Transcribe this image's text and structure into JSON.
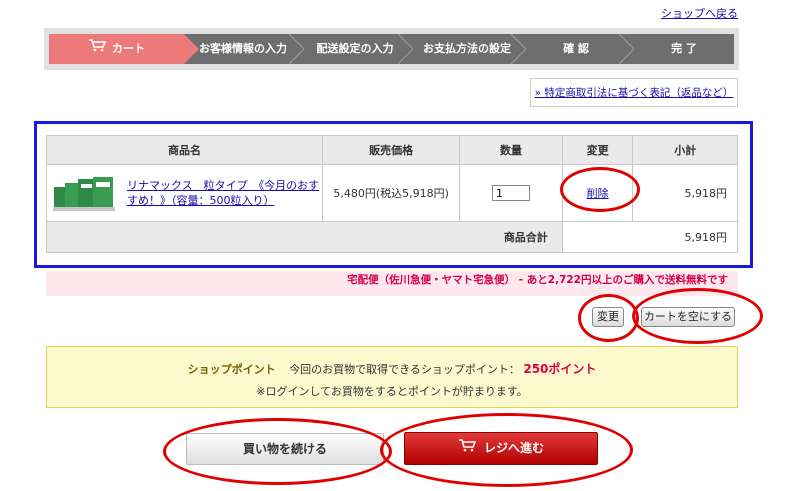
{
  "header": {
    "back_link": "ショップへ戻る"
  },
  "steps": [
    {
      "label": "カート",
      "active": true
    },
    {
      "label": "お客様情報の入力",
      "active": false
    },
    {
      "label": "配送設定の入力",
      "active": false
    },
    {
      "label": "お支払方法の設定",
      "active": false
    },
    {
      "label": "確 認",
      "active": false
    },
    {
      "label": "完 了",
      "active": false
    }
  ],
  "tokusho_link": "» 特定商取引法に基づく表記（返品など）",
  "cart": {
    "columns": [
      "商品名",
      "販売価格",
      "数量",
      "変更",
      "小計"
    ],
    "items": [
      {
        "name": "リナマックス　粒タイプ　《今月のおすすめ！》（容量：500粒入り）",
        "price": "5,480円(税込5,918円)",
        "quantity": "1",
        "change": "削除",
        "subtotal": "5,918円"
      }
    ],
    "total_label": "商品合計",
    "total_value": "5,918円"
  },
  "shipping_notice": "宅配便（佐川急便・ヤマト宅急便） - あと2,722円以上のご購入で送料無料です",
  "buttons": {
    "update": "変更",
    "empty_cart": "カートを空にする",
    "continue_shopping": "買い物を続ける",
    "checkout": "レジへ進む"
  },
  "points": {
    "label": "ショップポイント",
    "text": "今回のお買物で取得できるショップポイント：",
    "value": "250ポイント",
    "note": "※ログインしてお買物をするとポイントが貯まります。"
  },
  "colors": {
    "step_active": "#ec7a7a",
    "step_inactive": "#6e6e6e",
    "checkout_button": "#c40000",
    "annotation_red": "#e00000",
    "annotation_blue": "#1a1adb"
  }
}
